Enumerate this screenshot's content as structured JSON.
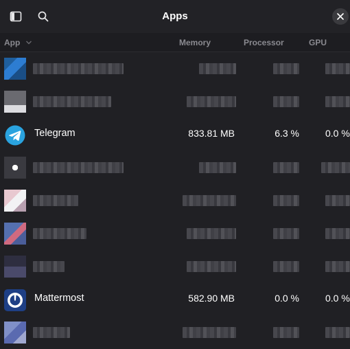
{
  "header": {
    "title": "Apps",
    "sidebar_icon": "sidebar-toggle-icon",
    "search_icon": "search-icon",
    "close_icon": "close-icon"
  },
  "columns": {
    "app": "App",
    "memory": "Memory",
    "processor": "Processor",
    "gpu": "GPU"
  },
  "apps": [
    {
      "name": "Telegram",
      "memory": "833.81 MB",
      "processor": "6.3 %",
      "gpu": "0.0 %"
    },
    {
      "name": "Mattermost",
      "memory": "582.90 MB",
      "processor": "0.0 %",
      "gpu": "0.0 %"
    }
  ],
  "colors": {
    "background": "#202024",
    "header_text": "#8a8a90",
    "telegram_blue": "#2aa3df",
    "mattermost_blue": "#1e3f85"
  }
}
